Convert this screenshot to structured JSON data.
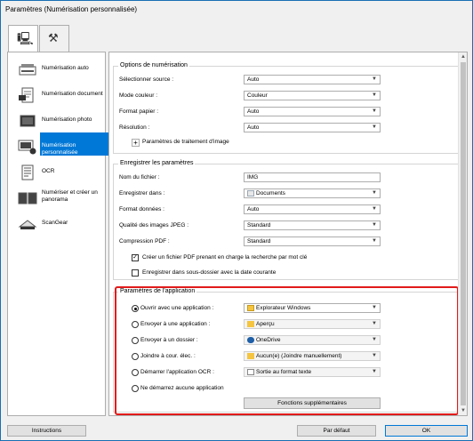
{
  "window": {
    "title": "Paramètres (Numérisation personnalisée)"
  },
  "tabs": [
    {
      "icon": "scanner-icon"
    },
    {
      "icon": "tools-icon"
    }
  ],
  "sidebar": {
    "items": [
      {
        "label": "Numérisation auto"
      },
      {
        "label": "Numérisation document"
      },
      {
        "label": "Numérisation photo"
      },
      {
        "label": "Numérisation personnalisée",
        "selected": true
      },
      {
        "label": "OCR"
      },
      {
        "label_line1": "Numériser et créer un",
        "label_line2": "panorama"
      },
      {
        "label": "ScanGear"
      }
    ]
  },
  "scan_options": {
    "title": "Options de numérisation",
    "source": {
      "label": "Sélectionner source :",
      "value": "Auto"
    },
    "color_mode": {
      "label": "Mode couleur :",
      "value": "Couleur"
    },
    "paper_size": {
      "label": "Format papier :",
      "value": "Auto"
    },
    "resolution": {
      "label": "Résolution :",
      "value": "Auto"
    },
    "image_processing": {
      "label": "Paramètres de traitement d'image"
    }
  },
  "save_settings": {
    "title": "Enregistrer les paramètres",
    "file_name": {
      "label": "Nom du fichier :",
      "value": "IMG"
    },
    "save_in": {
      "label": "Enregistrer dans :",
      "value": "Documents"
    },
    "data_format": {
      "label": "Format données :",
      "value": "Auto"
    },
    "jpeg_quality": {
      "label": "Qualité des images JPEG :",
      "value": "Standard"
    },
    "pdf_compression": {
      "label": "Compression PDF :",
      "value": "Standard"
    },
    "searchable_pdf": {
      "label": "Créer un fichier PDF prenant en charge la recherche par mot clé",
      "checked": true
    },
    "date_subfolder": {
      "label": "Enregistrer dans sous-dossier avec la date courante",
      "checked": false
    }
  },
  "app_settings": {
    "title": "Paramètres de l'application",
    "open_with": {
      "label": "Ouvrir avec une application :",
      "value": "Explorateur Windows",
      "selected": true
    },
    "send_to_app": {
      "label": "Envoyer à une application :",
      "value": "Aperçu"
    },
    "send_to_folder": {
      "label": "Envoyer à un dossier :",
      "value": "OneDrive"
    },
    "attach_email": {
      "label": "Joindre à cour. élec. :",
      "value": "Aucun(e) (Joindre manuellement)"
    },
    "start_ocr": {
      "label": "Démarrer l'application OCR :",
      "value": "Sortie au format texte"
    },
    "no_app": {
      "label": "Ne démarrez aucune application"
    },
    "more_functions": "Fonctions supplémentaires"
  },
  "footer": {
    "instructions": "Instructions",
    "defaults": "Par défaut",
    "ok": "OK"
  },
  "colors": {
    "accent": "#0078d7",
    "highlight": "#e11b1b"
  }
}
